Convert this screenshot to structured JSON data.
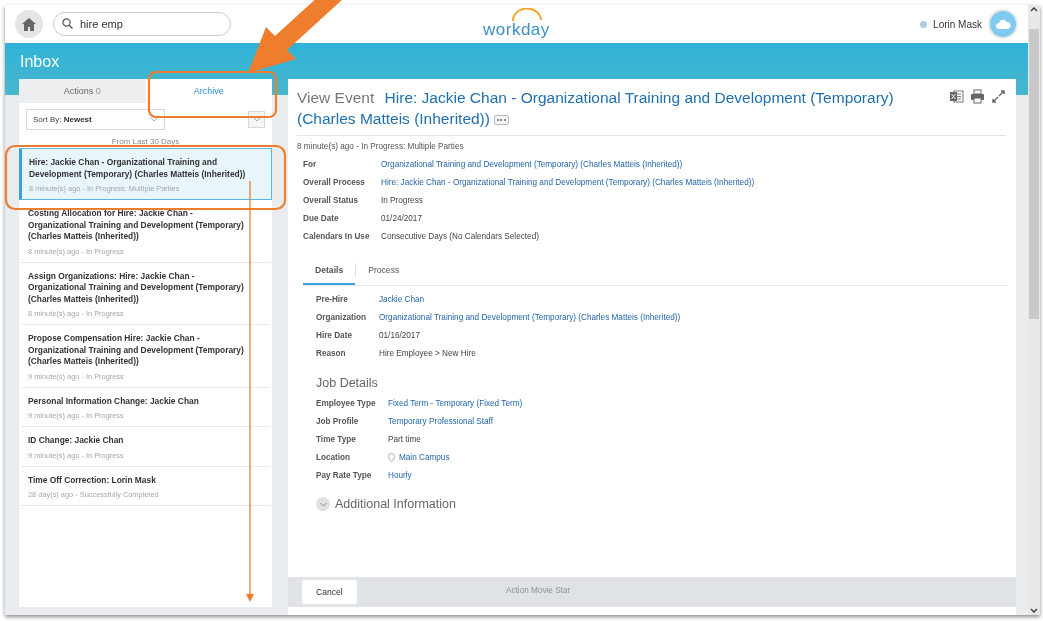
{
  "header": {
    "search": {
      "value": "hire emp"
    },
    "logo": "workday",
    "user": {
      "name": "Lorin Mask"
    }
  },
  "page_title": "Inbox",
  "tabs": [
    {
      "label": "Actions",
      "count": "0",
      "selected": false
    },
    {
      "label": "Archive",
      "selected": true
    }
  ],
  "sort": {
    "label": "Sort By:",
    "value": "Newest"
  },
  "list_caption": "From Last 30 Days",
  "inbox_items": [
    {
      "title": "Hire: Jackie Chan - Organizational Training and Development (Temporary) (Charles Matteis (Inherited))",
      "status": "8 minute(s) ago - In Progress: Multiple Parties",
      "selected": true
    },
    {
      "title": "Costing Allocation for Hire: Jackie Chan - Organizational Training and Development (Temporary) (Charles Matteis (Inherited))",
      "status": "8 minute(s) ago - In Progress",
      "selected": false
    },
    {
      "title": "Assign Organizations: Hire: Jackie Chan - Organizational Training and Development (Temporary) (Charles Matteis (Inherited))",
      "status": "8 minute(s) ago - In Progress",
      "selected": false
    },
    {
      "title": "Propose Compensation Hire: Jackie Chan - Organizational Training and Development (Temporary) (Charles Matteis (Inherited))",
      "status": "9 minute(s) ago - In Progress",
      "selected": false
    },
    {
      "title": "Personal Information Change: Jackie Chan",
      "status": "9 minute(s) ago - In Progress",
      "selected": false
    },
    {
      "title": "ID Change: Jackie Chan",
      "status": "9 minute(s) ago - In Progress",
      "selected": false
    },
    {
      "title": "Time Off Correction: Lorin Mask",
      "status": "28 day(s) ago - Successfully Completed",
      "selected": false
    }
  ],
  "event": {
    "prefix": "View Event",
    "title": "Hire: Jackie Chan - Organizational Training and Development (Temporary) (Charles Matteis (Inherited))",
    "status": "8 minute(s) ago - In Progress: Multiple Parties",
    "fields": [
      {
        "label": "For",
        "value": "Organizational Training and Development (Temporary) (Charles Matteis (Inherited))",
        "kind": "link"
      },
      {
        "label": "Overall Process",
        "value": "Hire: Jackie Chan - Organizational Training and Development (Temporary) (Charles Matteis (Inherited))",
        "kind": "link"
      },
      {
        "label": "Overall Status",
        "value": "In Progress",
        "kind": "text"
      },
      {
        "label": "Due Date",
        "value": "01/24/2017",
        "kind": "text"
      },
      {
        "label": "Calendars In Use",
        "value": "Consecutive Days (No Calendars Selected)",
        "kind": "text"
      }
    ],
    "tabs": [
      {
        "label": "Details",
        "selected": true
      },
      {
        "label": "Process",
        "selected": false
      }
    ],
    "details": [
      {
        "label": "Pre-Hire",
        "value": "Jackie Chan",
        "kind": "link"
      },
      {
        "label": "Organization",
        "value": "Organizational Training and Development (Temporary) (Charles Matteis (Inherited))",
        "kind": "link"
      },
      {
        "label": "Hire Date",
        "value": "01/16/2017",
        "kind": "text"
      },
      {
        "label": "Reason",
        "value": "Hire Employee > New Hire",
        "kind": "text"
      }
    ],
    "job_details_title": "Job Details",
    "job_details": [
      {
        "label": "Employee Type",
        "value": "Fixed Term - Temporary (Fixed Term)",
        "kind": "link"
      },
      {
        "label": "Job Profile",
        "value": "Temporary Professional Staff",
        "kind": "link"
      },
      {
        "label": "Time Type",
        "value": "Part time",
        "kind": "text"
      },
      {
        "label": "Location",
        "value": "Main Campus",
        "kind": "location"
      },
      {
        "label": "Pay Rate Type",
        "value": "Hourly",
        "kind": "link"
      }
    ],
    "additional_title": "Additional Information",
    "covered_value": "Action Movie Star"
  },
  "footer": {
    "cancel": "Cancel"
  }
}
